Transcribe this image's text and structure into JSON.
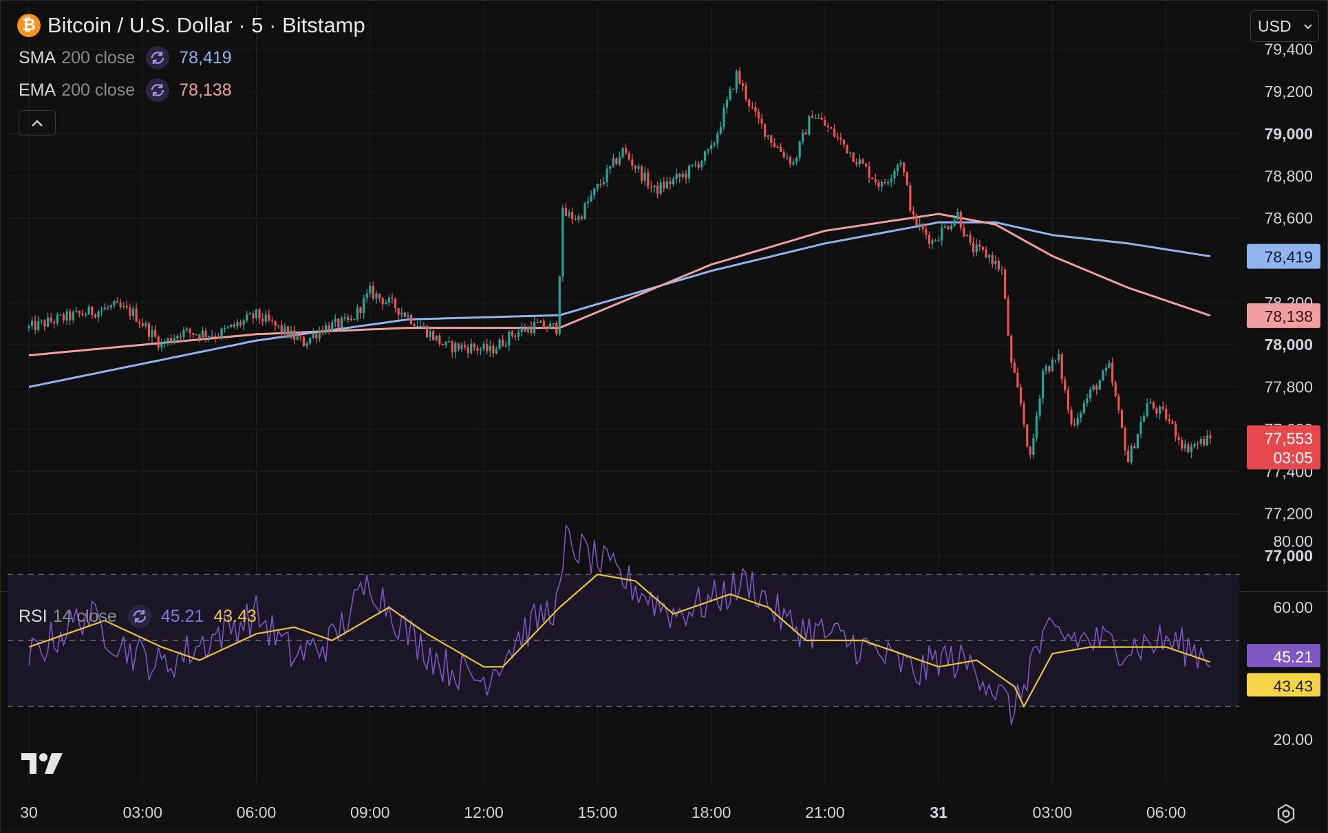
{
  "header": {
    "title": "Bitcoin / U.S. Dollar · 5 · Bitstamp",
    "coin_icon": "bitcoin-icon",
    "currency_select": "USD"
  },
  "indicators": {
    "sma": {
      "name": "SMA",
      "params": "200 close",
      "value": "78,419",
      "color": "#90b4f0"
    },
    "ema": {
      "name": "EMA",
      "params": "200 close",
      "value": "78,138",
      "color": "#f0a0a0"
    },
    "rsi": {
      "name": "RSI",
      "params": "14 close",
      "value": "45.21",
      "ma_value": "43.43",
      "color": "#7e57c2",
      "ma_color": "#e8c53a"
    }
  },
  "price_axis": {
    "ticks": [
      "79,400",
      "79,200",
      "79,000",
      "78,800",
      "78,600",
      "78,200",
      "78,000",
      "77,800",
      "77,600",
      "77,400",
      "77,200",
      "77,000"
    ],
    "bold_ticks": [
      "79,000",
      "78,000",
      "77,000"
    ],
    "sma_label": "78,419",
    "ema_label": "78,138",
    "last_price": "77,553",
    "countdown": "03:05"
  },
  "rsi_axis": {
    "ticks": [
      "80.00",
      "60.00",
      "20.00"
    ],
    "rsi_label": "45.21",
    "ma_label": "43.43"
  },
  "time_axis": {
    "ticks": [
      "30",
      "03:00",
      "06:00",
      "09:00",
      "12:00",
      "15:00",
      "18:00",
      "21:00",
      "31",
      "03:00",
      "06:00"
    ],
    "bold_ticks": [
      "31"
    ]
  },
  "colors": {
    "up": "#26a69a",
    "down": "#ef5350",
    "background": "#0f0f0f",
    "grid": "#1f1f22"
  },
  "chart_data": [
    {
      "type": "candlestick",
      "title": "Bitcoin / U.S. Dollar · 5 · Bitstamp",
      "interval_minutes": 5,
      "ylim": [
        76850,
        79500
      ],
      "x_range": [
        "30 00:00",
        "31 07:10"
      ],
      "close_anchors": [
        [
          "30 00:00",
          78080
        ],
        [
          "30 00:45",
          78120
        ],
        [
          "30 01:30",
          78150
        ],
        [
          "30 02:15",
          78180
        ],
        [
          "30 02:45",
          78150
        ],
        [
          "30 03:15",
          78050
        ],
        [
          "30 03:30",
          78000
        ],
        [
          "30 04:00",
          78060
        ],
        [
          "30 05:00",
          78050
        ],
        [
          "30 06:00",
          78140
        ],
        [
          "30 06:45",
          78060
        ],
        [
          "30 07:15",
          78010
        ],
        [
          "30 07:45",
          78080
        ],
        [
          "30 08:30",
          78110
        ],
        [
          "30 09:00",
          78250
        ],
        [
          "30 09:40",
          78180
        ],
        [
          "30 10:20",
          78090
        ],
        [
          "30 11:00",
          77990
        ],
        [
          "30 11:40",
          77990
        ],
        [
          "30 12:10",
          77970
        ],
        [
          "30 12:45",
          78050
        ],
        [
          "30 13:20",
          78090
        ],
        [
          "30 13:55",
          78080
        ],
        [
          "30 14:05",
          78620
        ],
        [
          "30 14:30",
          78600
        ],
        [
          "30 14:50",
          78700
        ],
        [
          "30 15:40",
          78920
        ],
        [
          "30 16:30",
          78730
        ],
        [
          "30 17:20",
          78810
        ],
        [
          "30 18:00",
          78920
        ],
        [
          "30 18:40",
          79280
        ],
        [
          "30 19:10",
          79080
        ],
        [
          "30 19:40",
          78950
        ],
        [
          "30 20:10",
          78860
        ],
        [
          "30 20:40",
          79100
        ],
        [
          "30 21:20",
          78980
        ],
        [
          "30 21:50",
          78880
        ],
        [
          "30 22:30",
          78750
        ],
        [
          "30 23:00",
          78880
        ],
        [
          "30 23:20",
          78590
        ],
        [
          "30 23:50",
          78490
        ],
        [
          "31 00:30",
          78620
        ],
        [
          "31 00:50",
          78460
        ],
        [
          "31 01:20",
          78420
        ],
        [
          "31 01:40",
          78350
        ],
        [
          "31 01:55",
          77900
        ],
        [
          "31 02:10",
          77720
        ],
        [
          "31 02:25",
          77450
        ],
        [
          "31 02:45",
          77880
        ],
        [
          "31 03:10",
          77930
        ],
        [
          "31 03:30",
          77620
        ],
        [
          "31 04:00",
          77770
        ],
        [
          "31 04:30",
          77890
        ],
        [
          "31 05:00",
          77450
        ],
        [
          "31 05:30",
          77720
        ],
        [
          "31 06:00",
          77660
        ],
        [
          "31 06:30",
          77510
        ],
        [
          "31 07:10",
          77553
        ]
      ],
      "series": [
        {
          "name": "SMA 200 close",
          "color": "#90b4f0",
          "points": [
            [
              "30 00:00",
              77800
            ],
            [
              "30 06:00",
              78020
            ],
            [
              "30 10:00",
              78120
            ],
            [
              "30 14:00",
              78140
            ],
            [
              "30 18:00",
              78350
            ],
            [
              "30 21:00",
              78480
            ],
            [
              "31 00:00",
              78580
            ],
            [
              "31 01:30",
              78580
            ],
            [
              "31 03:00",
              78520
            ],
            [
              "31 05:00",
              78480
            ],
            [
              "31 07:10",
              78419
            ]
          ]
        },
        {
          "name": "EMA 200 close",
          "color": "#f0a0a0",
          "points": [
            [
              "30 00:00",
              77950
            ],
            [
              "30 06:00",
              78050
            ],
            [
              "30 10:00",
              78080
            ],
            [
              "30 14:00",
              78080
            ],
            [
              "30 18:00",
              78380
            ],
            [
              "30 21:00",
              78540
            ],
            [
              "31 00:00",
              78620
            ],
            [
              "31 01:30",
              78570
            ],
            [
              "31 03:00",
              78420
            ],
            [
              "31 05:00",
              78270
            ],
            [
              "31 07:10",
              78138
            ]
          ]
        }
      ]
    },
    {
      "type": "line",
      "title": "RSI 14 close",
      "ylim": [
        10,
        90
      ],
      "bands": [
        30,
        50,
        70
      ],
      "series": [
        {
          "name": "RSI",
          "color": "#7e57c2",
          "points": [
            [
              "30 00:00",
              45
            ],
            [
              "30 01:30",
              58
            ],
            [
              "30 02:30",
              48
            ],
            [
              "30 03:30",
              42
            ],
            [
              "30 05:00",
              52
            ],
            [
              "30 06:00",
              58
            ],
            [
              "30 07:00",
              45
            ],
            [
              "30 08:00",
              50
            ],
            [
              "30 09:00",
              68
            ],
            [
              "30 10:00",
              52
            ],
            [
              "30 11:00",
              42
            ],
            [
              "30 12:00",
              38
            ],
            [
              "30 13:00",
              52
            ],
            [
              "30 14:00",
              62
            ],
            [
              "30 14:10",
              80
            ],
            [
              "30 15:00",
              74
            ],
            [
              "30 16:00",
              66
            ],
            [
              "30 17:00",
              58
            ],
            [
              "30 18:00",
              62
            ],
            [
              "30 19:00",
              68
            ],
            [
              "30 20:00",
              55
            ],
            [
              "30 21:00",
              52
            ],
            [
              "30 22:00",
              48
            ],
            [
              "30 23:30",
              40
            ],
            [
              "31 00:00",
              45
            ],
            [
              "31 01:00",
              42
            ],
            [
              "31 02:00",
              28
            ],
            [
              "31 02:30",
              46
            ],
            [
              "31 03:00",
              52
            ],
            [
              "31 04:00",
              50
            ],
            [
              "31 05:00",
              48
            ],
            [
              "31 06:00",
              50
            ],
            [
              "31 07:10",
              45.21
            ]
          ]
        },
        {
          "name": "RSI-based MA",
          "color": "#e8c53a",
          "points": [
            [
              "30 00:00",
              48
            ],
            [
              "30 02:00",
              56
            ],
            [
              "30 03:30",
              48
            ],
            [
              "30 04:30",
              44
            ],
            [
              "30 06:00",
              52
            ],
            [
              "30 07:00",
              54
            ],
            [
              "30 08:00",
              50
            ],
            [
              "30 09:30",
              60
            ],
            [
              "30 10:30",
              52
            ],
            [
              "30 12:00",
              42
            ],
            [
              "30 12:30",
              42
            ],
            [
              "30 14:00",
              60
            ],
            [
              "30 15:00",
              70
            ],
            [
              "30 16:00",
              68
            ],
            [
              "30 17:00",
              58
            ],
            [
              "30 18:30",
              64
            ],
            [
              "30 19:30",
              60
            ],
            [
              "30 20:30",
              50
            ],
            [
              "30 22:00",
              50
            ],
            [
              "31 00:00",
              42
            ],
            [
              "31 01:00",
              44
            ],
            [
              "31 02:00",
              36
            ],
            [
              "31 02:15",
              30
            ],
            [
              "31 03:00",
              46
            ],
            [
              "31 04:00",
              48
            ],
            [
              "31 05:00",
              48
            ],
            [
              "31 06:00",
              48
            ],
            [
              "31 07:10",
              43.43
            ]
          ]
        }
      ]
    }
  ]
}
